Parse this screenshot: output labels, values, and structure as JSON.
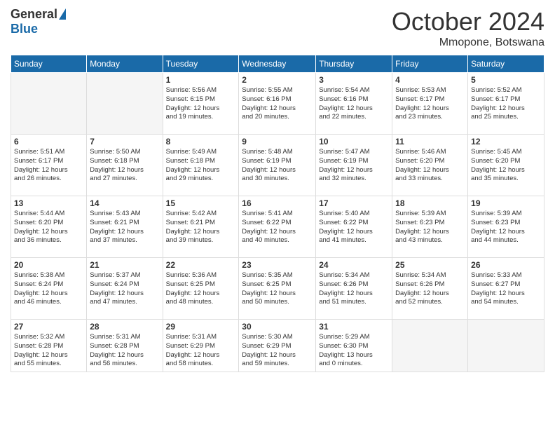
{
  "header": {
    "logo_general": "General",
    "logo_blue": "Blue",
    "month_title": "October 2024",
    "location": "Mmopone, Botswana"
  },
  "days_of_week": [
    "Sunday",
    "Monday",
    "Tuesday",
    "Wednesday",
    "Thursday",
    "Friday",
    "Saturday"
  ],
  "weeks": [
    [
      {
        "day": "",
        "info": ""
      },
      {
        "day": "",
        "info": ""
      },
      {
        "day": "1",
        "info": "Sunrise: 5:56 AM\nSunset: 6:15 PM\nDaylight: 12 hours\nand 19 minutes."
      },
      {
        "day": "2",
        "info": "Sunrise: 5:55 AM\nSunset: 6:16 PM\nDaylight: 12 hours\nand 20 minutes."
      },
      {
        "day": "3",
        "info": "Sunrise: 5:54 AM\nSunset: 6:16 PM\nDaylight: 12 hours\nand 22 minutes."
      },
      {
        "day": "4",
        "info": "Sunrise: 5:53 AM\nSunset: 6:17 PM\nDaylight: 12 hours\nand 23 minutes."
      },
      {
        "day": "5",
        "info": "Sunrise: 5:52 AM\nSunset: 6:17 PM\nDaylight: 12 hours\nand 25 minutes."
      }
    ],
    [
      {
        "day": "6",
        "info": "Sunrise: 5:51 AM\nSunset: 6:17 PM\nDaylight: 12 hours\nand 26 minutes."
      },
      {
        "day": "7",
        "info": "Sunrise: 5:50 AM\nSunset: 6:18 PM\nDaylight: 12 hours\nand 27 minutes."
      },
      {
        "day": "8",
        "info": "Sunrise: 5:49 AM\nSunset: 6:18 PM\nDaylight: 12 hours\nand 29 minutes."
      },
      {
        "day": "9",
        "info": "Sunrise: 5:48 AM\nSunset: 6:19 PM\nDaylight: 12 hours\nand 30 minutes."
      },
      {
        "day": "10",
        "info": "Sunrise: 5:47 AM\nSunset: 6:19 PM\nDaylight: 12 hours\nand 32 minutes."
      },
      {
        "day": "11",
        "info": "Sunrise: 5:46 AM\nSunset: 6:20 PM\nDaylight: 12 hours\nand 33 minutes."
      },
      {
        "day": "12",
        "info": "Sunrise: 5:45 AM\nSunset: 6:20 PM\nDaylight: 12 hours\nand 35 minutes."
      }
    ],
    [
      {
        "day": "13",
        "info": "Sunrise: 5:44 AM\nSunset: 6:20 PM\nDaylight: 12 hours\nand 36 minutes."
      },
      {
        "day": "14",
        "info": "Sunrise: 5:43 AM\nSunset: 6:21 PM\nDaylight: 12 hours\nand 37 minutes."
      },
      {
        "day": "15",
        "info": "Sunrise: 5:42 AM\nSunset: 6:21 PM\nDaylight: 12 hours\nand 39 minutes."
      },
      {
        "day": "16",
        "info": "Sunrise: 5:41 AM\nSunset: 6:22 PM\nDaylight: 12 hours\nand 40 minutes."
      },
      {
        "day": "17",
        "info": "Sunrise: 5:40 AM\nSunset: 6:22 PM\nDaylight: 12 hours\nand 41 minutes."
      },
      {
        "day": "18",
        "info": "Sunrise: 5:39 AM\nSunset: 6:23 PM\nDaylight: 12 hours\nand 43 minutes."
      },
      {
        "day": "19",
        "info": "Sunrise: 5:39 AM\nSunset: 6:23 PM\nDaylight: 12 hours\nand 44 minutes."
      }
    ],
    [
      {
        "day": "20",
        "info": "Sunrise: 5:38 AM\nSunset: 6:24 PM\nDaylight: 12 hours\nand 46 minutes."
      },
      {
        "day": "21",
        "info": "Sunrise: 5:37 AM\nSunset: 6:24 PM\nDaylight: 12 hours\nand 47 minutes."
      },
      {
        "day": "22",
        "info": "Sunrise: 5:36 AM\nSunset: 6:25 PM\nDaylight: 12 hours\nand 48 minutes."
      },
      {
        "day": "23",
        "info": "Sunrise: 5:35 AM\nSunset: 6:25 PM\nDaylight: 12 hours\nand 50 minutes."
      },
      {
        "day": "24",
        "info": "Sunrise: 5:34 AM\nSunset: 6:26 PM\nDaylight: 12 hours\nand 51 minutes."
      },
      {
        "day": "25",
        "info": "Sunrise: 5:34 AM\nSunset: 6:26 PM\nDaylight: 12 hours\nand 52 minutes."
      },
      {
        "day": "26",
        "info": "Sunrise: 5:33 AM\nSunset: 6:27 PM\nDaylight: 12 hours\nand 54 minutes."
      }
    ],
    [
      {
        "day": "27",
        "info": "Sunrise: 5:32 AM\nSunset: 6:28 PM\nDaylight: 12 hours\nand 55 minutes."
      },
      {
        "day": "28",
        "info": "Sunrise: 5:31 AM\nSunset: 6:28 PM\nDaylight: 12 hours\nand 56 minutes."
      },
      {
        "day": "29",
        "info": "Sunrise: 5:31 AM\nSunset: 6:29 PM\nDaylight: 12 hours\nand 58 minutes."
      },
      {
        "day": "30",
        "info": "Sunrise: 5:30 AM\nSunset: 6:29 PM\nDaylight: 12 hours\nand 59 minutes."
      },
      {
        "day": "31",
        "info": "Sunrise: 5:29 AM\nSunset: 6:30 PM\nDaylight: 13 hours\nand 0 minutes."
      },
      {
        "day": "",
        "info": ""
      },
      {
        "day": "",
        "info": ""
      }
    ]
  ]
}
